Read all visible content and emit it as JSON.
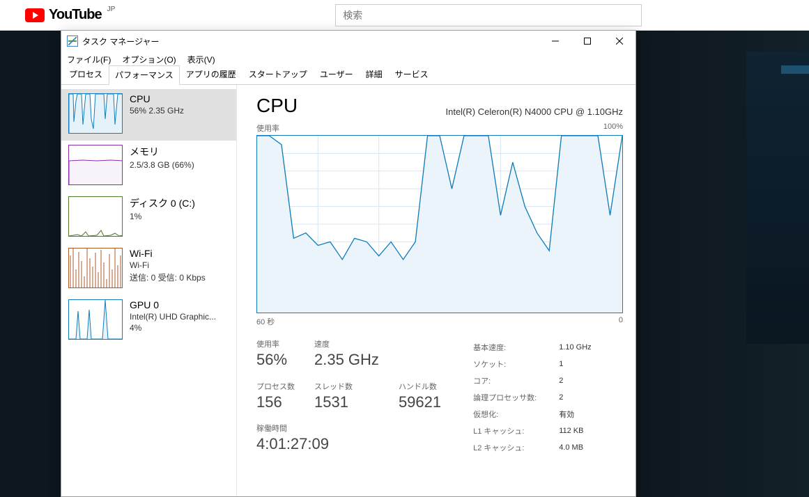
{
  "browser": {
    "logo_text": "YouTube",
    "region": "JP",
    "search_placeholder": "検索"
  },
  "window": {
    "title": "タスク マネージャー",
    "menus": [
      "ファイル(F)",
      "オプション(O)",
      "表示(V)"
    ],
    "tabs": [
      "プロセス",
      "パフォーマンス",
      "アプリの履歴",
      "スタートアップ",
      "ユーザー",
      "詳細",
      "サービス"
    ],
    "active_tab_index": 1
  },
  "sidebar": {
    "items": [
      {
        "title": "CPU",
        "sub1": "56%  2.35 GHz"
      },
      {
        "title": "メモリ",
        "sub1": "2.5/3.8 GB (66%)"
      },
      {
        "title": "ディスク 0 (C:)",
        "sub1": "1%"
      },
      {
        "title": "Wi-Fi",
        "sub1": "Wi-Fi",
        "sub2": "送信: 0  受信: 0 Kbps"
      },
      {
        "title": "GPU 0",
        "sub1": "Intel(R) UHD Graphic...",
        "sub2": "4%"
      }
    ]
  },
  "main": {
    "title": "CPU",
    "cpu_name": "Intel(R) Celeron(R) N4000 CPU @ 1.10GHz",
    "chart_top_left": "使用率",
    "chart_top_right": "100%",
    "chart_bottom_left": "60 秒",
    "chart_bottom_right": "0",
    "labels": {
      "usage": "使用率",
      "speed": "速度",
      "processes": "プロセス数",
      "threads": "スレッド数",
      "handles": "ハンドル数",
      "uptime": "稼働時間",
      "base": "基本速度:",
      "sockets": "ソケット:",
      "cores": "コア:",
      "logical": "論理プロセッサ数:",
      "virt": "仮想化:",
      "l1": "L1 キャッシュ:",
      "l2": "L2 キャッシュ:"
    },
    "values": {
      "usage": "56%",
      "speed": "2.35 GHz",
      "processes": "156",
      "threads": "1531",
      "handles": "59621",
      "uptime": "4:01:27:09",
      "base": "1.10 GHz",
      "sockets": "1",
      "cores": "2",
      "logical": "2",
      "virt": "有効",
      "l1": "112 KB",
      "l2": "4.0 MB"
    }
  },
  "chart_data": {
    "type": "line",
    "title": "CPU 使用率",
    "ylabel": "使用率",
    "xlabel": "",
    "ylim": [
      0,
      100
    ],
    "xlim_label": [
      "60 秒",
      "0"
    ],
    "x": [
      0,
      2,
      4,
      6,
      8,
      10,
      12,
      14,
      16,
      18,
      20,
      22,
      24,
      26,
      28,
      30,
      32,
      34,
      36,
      38,
      40,
      42,
      44,
      46,
      48,
      50,
      52,
      54,
      56,
      58,
      60
    ],
    "values": [
      100,
      100,
      95,
      42,
      45,
      38,
      40,
      30,
      42,
      40,
      32,
      40,
      30,
      40,
      100,
      100,
      70,
      100,
      100,
      100,
      55,
      85,
      60,
      45,
      35,
      100,
      100,
      100,
      100,
      55,
      100
    ]
  }
}
